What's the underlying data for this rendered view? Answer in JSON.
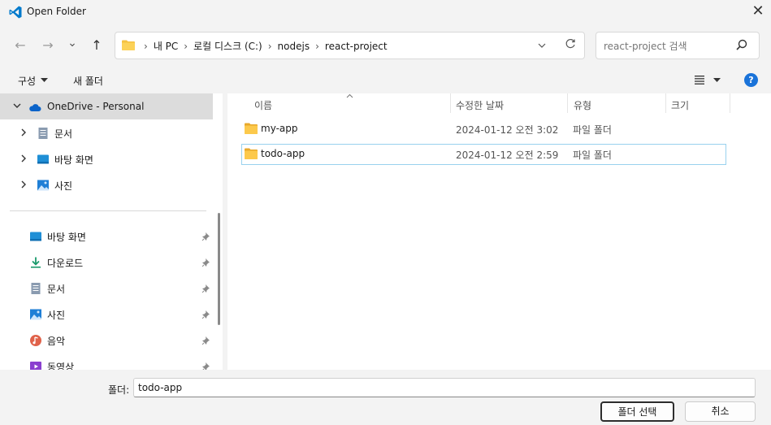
{
  "window": {
    "title": "Open Folder",
    "close_glyph": "✕"
  },
  "nav_buttons": {
    "back": "←",
    "forward": "→",
    "recent": "⌄",
    "up": "↑"
  },
  "address": {
    "crumbs": [
      "내 PC",
      "로컬 디스크 (C:)",
      "nodejs",
      "react-project"
    ]
  },
  "search": {
    "placeholder": "react-project 검색"
  },
  "toolbar": {
    "organize_label": "구성",
    "new_folder_label": "새 폴더",
    "help_glyph": "?"
  },
  "nav": {
    "tree": [
      {
        "label": "OneDrive - Personal",
        "icon": "cloud-icon",
        "expanded": true,
        "selected": true
      },
      {
        "label": "문서",
        "icon": "document-icon"
      },
      {
        "label": "바탕 화면",
        "icon": "desktop-icon"
      },
      {
        "label": "사진",
        "icon": "picture-icon"
      }
    ],
    "quick_access": [
      {
        "label": "바탕 화면",
        "icon": "desktop-icon"
      },
      {
        "label": "다운로드",
        "icon": "download-icon"
      },
      {
        "label": "문서",
        "icon": "document-icon"
      },
      {
        "label": "사진",
        "icon": "picture-icon"
      },
      {
        "label": "음악",
        "icon": "music-icon"
      },
      {
        "label": "동영상",
        "icon": "video-icon"
      }
    ]
  },
  "columns": {
    "name": "이름",
    "date": "수정한 날짜",
    "type": "유형",
    "size": "크기"
  },
  "files": [
    {
      "name": "my-app",
      "date": "2024-01-12 오전 3:02",
      "type": "파일 폴더"
    },
    {
      "name": "todo-app",
      "date": "2024-01-12 오전 2:59",
      "type": "파일 폴더",
      "selected": true
    }
  ],
  "bottom": {
    "folder_label": "폴더:",
    "folder_value": "todo-app",
    "select_button": "폴더 선택",
    "cancel_button": "취소"
  },
  "colors": {
    "accent": "#1a73d9",
    "selection_border": "#99d1ee",
    "vscode_blue": "#007acc",
    "folder_yellow": "#f5c242"
  }
}
